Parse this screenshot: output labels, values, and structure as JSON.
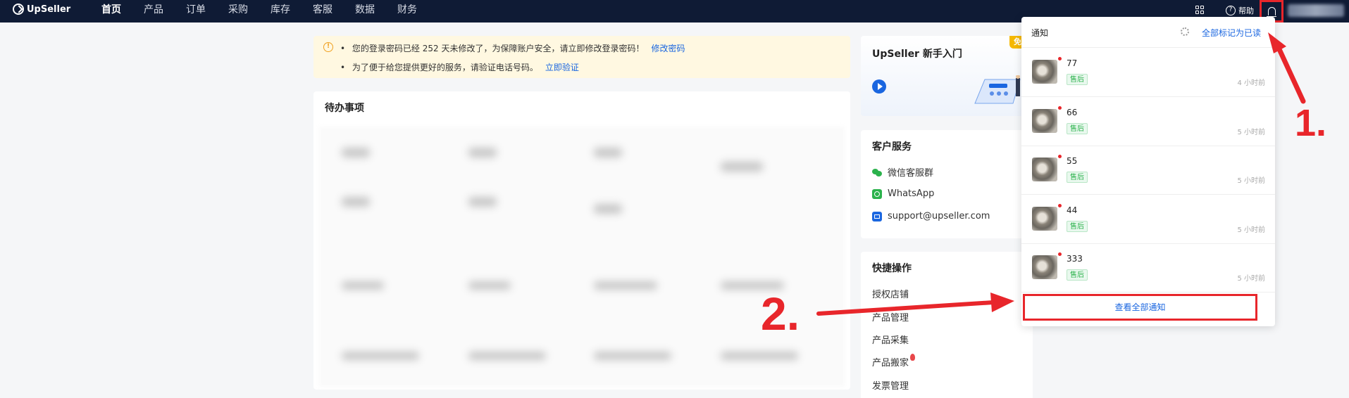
{
  "brand": {
    "name": "UpSeller"
  },
  "nav": {
    "items": [
      {
        "label": "首页",
        "active": true
      },
      {
        "label": "产品",
        "active": false
      },
      {
        "label": "订单",
        "active": false
      },
      {
        "label": "采购",
        "active": false
      },
      {
        "label": "库存",
        "active": false
      },
      {
        "label": "客服",
        "active": false
      },
      {
        "label": "数据",
        "active": false
      },
      {
        "label": "财务",
        "active": false
      }
    ],
    "help_label": "帮助"
  },
  "notice": {
    "line1": "您的登录密码已经 252 天未修改了，为保障账户安全，请立即修改登录密码！",
    "line1_link": "修改密码",
    "line2": "为了便于给您提供更好的服务，请验证电话号码。",
    "line2_link": "立即验证"
  },
  "todo": {
    "title": "待办事项"
  },
  "guide": {
    "title": "UpSeller 新手入门",
    "badge": "免"
  },
  "service": {
    "title": "客户服务",
    "items": [
      {
        "label": "微信客服群",
        "icon": "wechat-icon"
      },
      {
        "label": "WhatsApp",
        "icon": "whatsapp-icon"
      },
      {
        "label": "support@upseller.com",
        "icon": "mail-icon"
      }
    ]
  },
  "quick": {
    "title": "快捷操作",
    "items": [
      "授权店铺",
      "产品管理",
      "产品采集",
      "产品搬家",
      "发票管理"
    ]
  },
  "notifications": {
    "title": "通知",
    "mark_all": "全部标记为已读",
    "view_all": "查看全部通知",
    "items": [
      {
        "title": "77",
        "tag": "售后",
        "time": "4 小时前"
      },
      {
        "title": "66",
        "tag": "售后",
        "time": "5 小时前"
      },
      {
        "title": "55",
        "tag": "售后",
        "time": "5 小时前"
      },
      {
        "title": "44",
        "tag": "售后",
        "time": "5 小时前"
      },
      {
        "title": "333",
        "tag": "售后",
        "time": "5 小时前"
      }
    ]
  },
  "annotations": {
    "step1": "1.",
    "step2": "2.",
    "color": "#e8262b"
  }
}
